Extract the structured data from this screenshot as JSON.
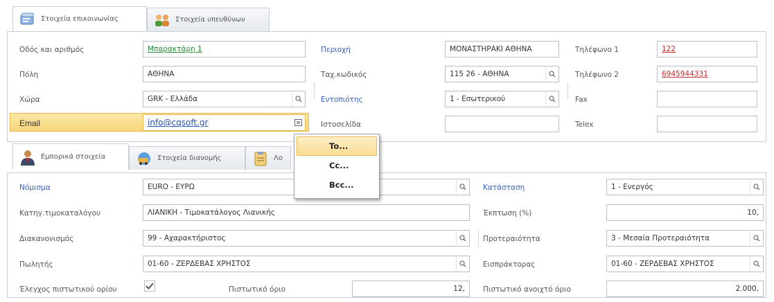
{
  "top_tabs": [
    {
      "label": "Στοιχεία επικοινωνίας",
      "icon": "contact-card-icon"
    },
    {
      "label": "Στοιχεία υπευθύνων",
      "icon": "people-icon"
    }
  ],
  "contact": {
    "street_label": "Οδός και αριθμός",
    "street_value": "Μπαρακτάρη 1",
    "city_label": "Πόλη",
    "city_value": "ΑΘΗΝΑ",
    "country_label": "Χώρα",
    "country_value": "GRK - Ελλάδα",
    "email_label": "Email",
    "email_value": "info@cqsoft.gr",
    "area_label": "Περιοχή",
    "area_value": "ΜΟΝΑΣΤΗΡΑΚΙ ΑΘΗΝΑ",
    "zip_label": "Ταχ.κωδικός",
    "zip_value": "115 26 - ΑΘΗΝΑ",
    "locality_label": "Εντοπιότης",
    "locality_value": "1 - Εσωτερικού",
    "website_label": "Ιστοσελίδα",
    "website_value": "",
    "phone1_label": "Τηλέφωνο 1",
    "phone1_value": "122",
    "phone2_label": "Τηλέφωνο 2",
    "phone2_value": "6945944331",
    "fax_label": "Fax",
    "fax_value": "",
    "telex_label": "Telex",
    "telex_value": ""
  },
  "email_menu": {
    "items": [
      "To...",
      "Cc...",
      "Bcc..."
    ],
    "highlighted": "To..."
  },
  "bottom_tabs": [
    {
      "label": "Εμπορικά στοιχεία",
      "icon": "businessman-icon"
    },
    {
      "label": "Στοιχεία διανομής",
      "icon": "delivery-icon"
    },
    {
      "label": "Λο",
      "icon": "clipboard-icon"
    }
  ],
  "commercial": {
    "currency_label": "Νόμισμα",
    "currency_value": "EURO - ΕΥΡΩ",
    "pricelist_label": "Κατηγ.τιμοκαταλόγου",
    "pricelist_value": "ΛΙΑΝΙΚΗ - Τιμοκατάλογος Λιανικής",
    "vat_label": "Διακανονισμός",
    "vat_value": "99 - Αχαρακτήριστος",
    "salesman_label": "Πωλητής",
    "salesman_value": "01-60 - ΖΕΡΔΕΒΑΣ ΧΡΗΣΤΟΣ",
    "credit_check_label": "Έλεγχος πιστωτικού ορίου",
    "credit_check_checked": true,
    "credit_limit_label": "Πιστωτικό όριο",
    "credit_limit_value": "12,",
    "status_label": "Κατάσταση",
    "status_value": "1 - Ενεργός",
    "discount_label": "Έκπτωση (%)",
    "discount_value": "10,",
    "priority_label": "Προτεραιότητα",
    "priority_value": "3 - Μεσαία Προτεραιότητα",
    "collector_label": "Εισπράκτορας",
    "collector_value": "01-60 - ΖΕΡΔΕΒΑΣ ΧΡΗΣΤΟΣ",
    "open_credit_label": "Πιστωτικό ανοιχτό όριο",
    "open_credit_value": "2.000,"
  },
  "colors": {
    "link_label": "#3b5fc0",
    "email_highlight": "#f7d77b",
    "menu_highlight": "#f8dc92",
    "phone_red": "#c23030"
  }
}
